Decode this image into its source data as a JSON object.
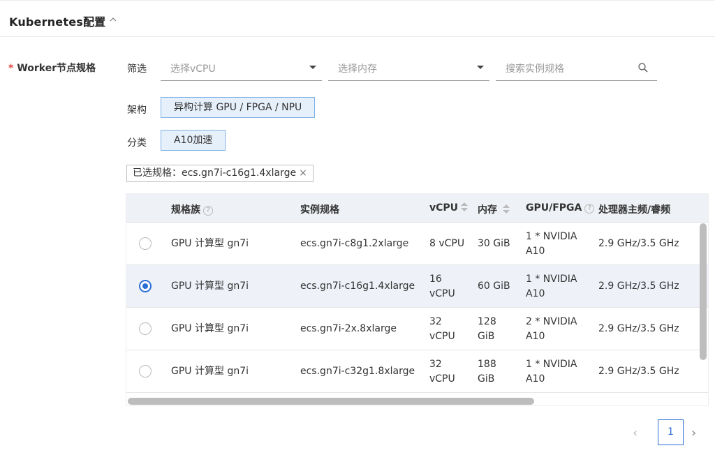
{
  "section": {
    "title": "Kubernetes配置"
  },
  "worker": {
    "label": "Worker节点规格",
    "required_mark": "*"
  },
  "filter": {
    "label": "筛选",
    "vcpu_placeholder": "选择vCPU",
    "memory_placeholder": "选择内存",
    "search_placeholder": "搜索实例规格"
  },
  "arch": {
    "label": "架构",
    "selected": "异构计算 GPU / FPGA / NPU"
  },
  "category": {
    "label": "分类",
    "selected": "A10加速"
  },
  "selected_spec": {
    "text": "已选规格：ecs.gn7i-c16g1.4xlarge",
    "close": "×"
  },
  "table": {
    "headers": {
      "family": "规格族",
      "instance": "实例规格",
      "vcpu": "vCPU",
      "memory": "内存",
      "gpu": "GPU/FPGA",
      "freq": "处理器主频/睿频"
    },
    "rows": [
      {
        "family": "GPU 计算型 gn7i",
        "instance": "ecs.gn7i-c8g1.2xlarge",
        "vcpu": "8 vCPU",
        "memory": "30 GiB",
        "gpu": "1 * NVIDIA A10",
        "freq": "2.9 GHz/3.5 GHz",
        "selected": false
      },
      {
        "family": "GPU 计算型 gn7i",
        "instance": "ecs.gn7i-c16g1.4xlarge",
        "vcpu": "16 vCPU",
        "memory": "60 GiB",
        "gpu": "1 * NVIDIA A10",
        "freq": "2.9 GHz/3.5 GHz",
        "selected": true
      },
      {
        "family": "GPU 计算型 gn7i",
        "instance": "ecs.gn7i-2x.8xlarge",
        "vcpu": "32 vCPU",
        "memory": "128 GiB",
        "gpu": "2 * NVIDIA A10",
        "freq": "2.9 GHz/3.5 GHz",
        "selected": false
      },
      {
        "family": "GPU 计算型 gn7i",
        "instance": "ecs.gn7i-c32g1.8xlarge",
        "vcpu": "32 vCPU",
        "memory": "188 GiB",
        "gpu": "1 * NVIDIA A10",
        "freq": "2.9 GHz/3.5 GHz",
        "selected": false
      }
    ]
  },
  "pagination": {
    "current_page": "1",
    "prev": "‹",
    "next": "›"
  },
  "colors": {
    "accent": "#2a6ed6",
    "chip_bg": "#e6f0fb",
    "required": "#e54545"
  }
}
